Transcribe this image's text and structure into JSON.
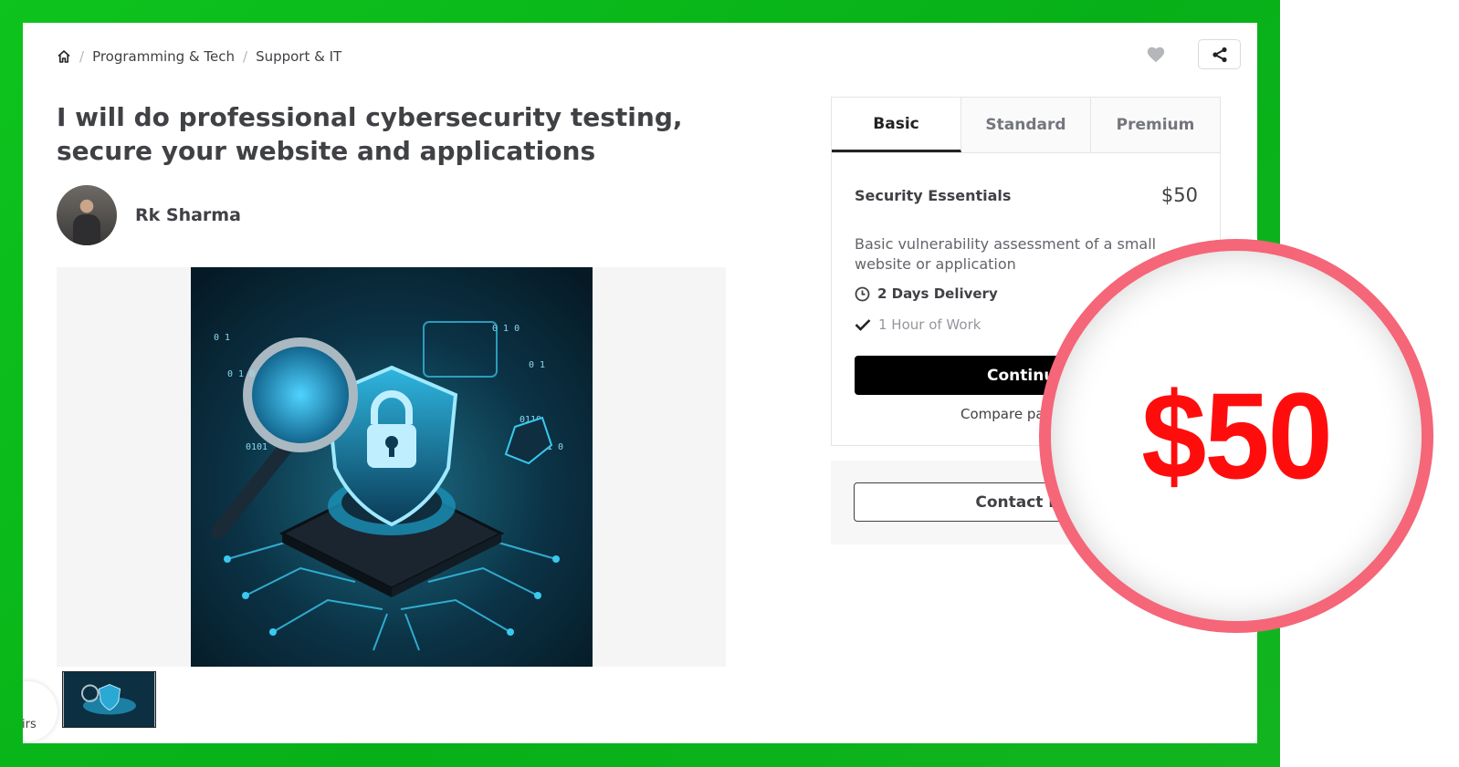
{
  "breadcrumb": {
    "items": [
      "Programming & Tech",
      "Support & IT"
    ],
    "separator": "/"
  },
  "gig": {
    "title": "I will do professional cybersecurity testing, secure your website and applications"
  },
  "seller": {
    "name": "Rk Sharma"
  },
  "gallery": {
    "chat_label": "irs"
  },
  "pricing": {
    "tabs": [
      {
        "label": "Basic",
        "active": true
      },
      {
        "label": "Standard",
        "active": false
      },
      {
        "label": "Premium",
        "active": false
      }
    ],
    "package_name": "Security Essentials",
    "price": "$50",
    "description": "Basic vulnerability assessment of a small website or application",
    "delivery": "2 Days Delivery",
    "revisions": "1 Hour of Work",
    "continue_label": "Continue",
    "compare_label": "Compare packages"
  },
  "contact": {
    "label": "Contact me"
  },
  "badge": {
    "price": "$50"
  },
  "colors": {
    "frame_green": "#0ec31e",
    "badge_ring": "#f46678",
    "badge_text": "#ff0d0d",
    "text_dark": "#404145"
  }
}
